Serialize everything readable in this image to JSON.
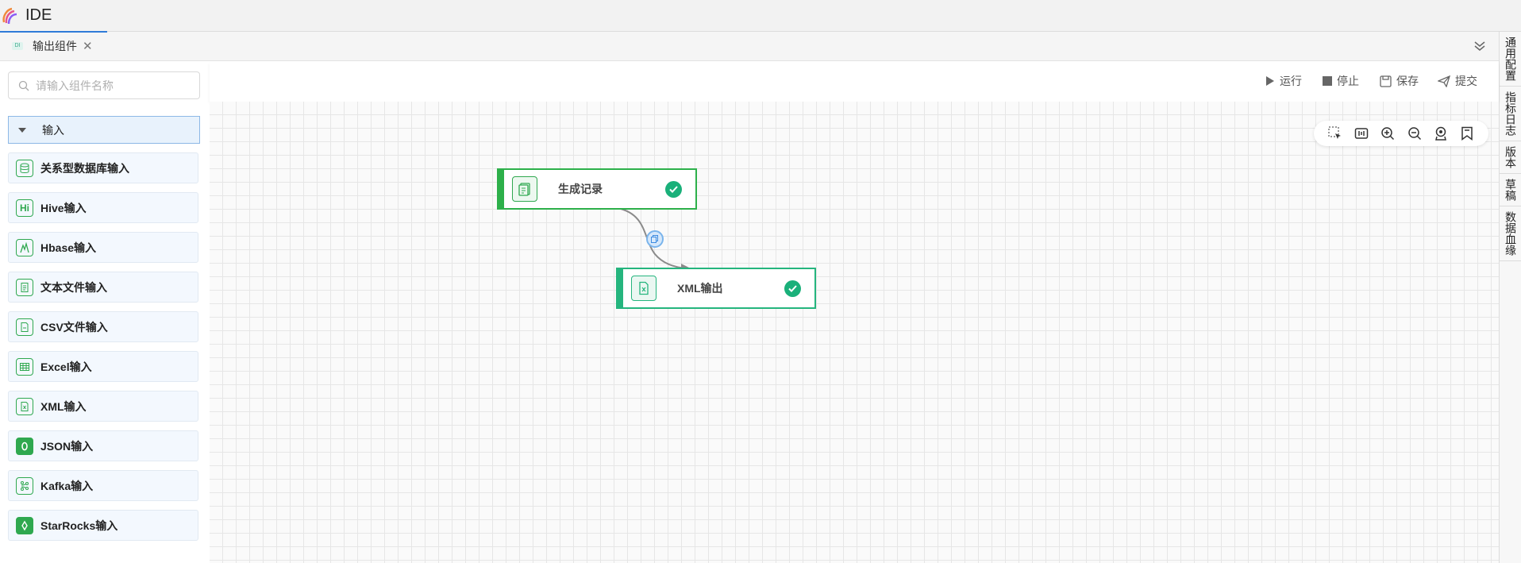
{
  "app": {
    "title": "IDE"
  },
  "tabs": [
    {
      "icon_text": "DI",
      "label": "输出组件",
      "active": true
    }
  ],
  "right_panel": {
    "items": [
      {
        "label": "通用配置"
      },
      {
        "label": "指标日志"
      },
      {
        "label": "版本"
      },
      {
        "label": "草稿"
      },
      {
        "label": "数据血缘"
      }
    ]
  },
  "left_panel": {
    "search": {
      "placeholder": "请输入组件名称",
      "value": ""
    },
    "group": {
      "label": "输入",
      "expanded": true
    },
    "components": [
      {
        "label": "关系型数据库输入",
        "icon": "database-icon"
      },
      {
        "label": "Hive输入",
        "icon": "hive-icon",
        "icon_text": "Hi"
      },
      {
        "label": "Hbase输入",
        "icon": "hbase-icon"
      },
      {
        "label": "文本文件输入",
        "icon": "text-file-icon"
      },
      {
        "label": "CSV文件输入",
        "icon": "csv-file-icon"
      },
      {
        "label": "Excel输入",
        "icon": "excel-table-icon"
      },
      {
        "label": "XML输入",
        "icon": "xml-file-icon"
      },
      {
        "label": "JSON输入",
        "icon": "json-icon"
      },
      {
        "label": "Kafka输入",
        "icon": "kafka-icon"
      },
      {
        "label": "StarRocks输入",
        "icon": "starrocks-icon"
      }
    ]
  },
  "toolbar": {
    "run": "运行",
    "stop": "停止",
    "save": "保存",
    "submit": "提交"
  },
  "canvas_tools": [
    "box-select-icon",
    "fit-view-icon",
    "zoom-in-icon",
    "zoom-out-icon",
    "locate-icon",
    "bookmark-icon"
  ],
  "flow": {
    "nodes": [
      {
        "id": "gen",
        "label": "生成记录",
        "status": "success",
        "icon": "records-icon"
      },
      {
        "id": "xml",
        "label": "XML输出",
        "status": "success",
        "icon": "xml-file-icon"
      }
    ],
    "edges": [
      {
        "from": "gen",
        "to": "xml"
      }
    ]
  },
  "colors": {
    "accent": "#2f7bd8",
    "node_green": "#2db04a",
    "status_green": "#1ab07a",
    "component_bg": "#f3f8fe"
  }
}
